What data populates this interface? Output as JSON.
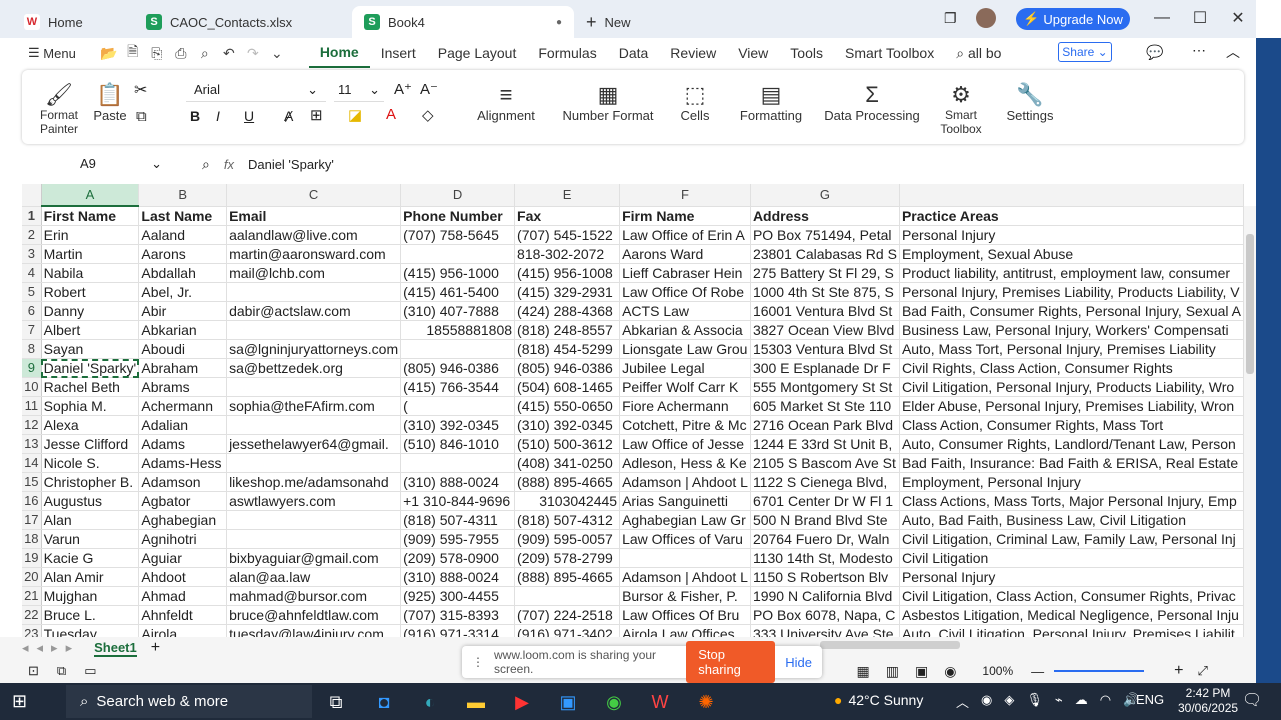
{
  "tabs": [
    {
      "label": "Home",
      "icon": "wps-logo-icon"
    },
    {
      "label": "CAOC_Contacts.xlsx",
      "icon": "spreadsheet-icon"
    },
    {
      "label": "Book4",
      "icon": "spreadsheet-icon"
    },
    {
      "label": "New"
    }
  ],
  "upgrade": "Upgrade Now",
  "menu": {
    "main": "Menu",
    "items": [
      "Home",
      "Insert",
      "Page Layout",
      "Formulas",
      "Data",
      "Review",
      "View",
      "Tools",
      "Smart Toolbox"
    ],
    "search_value": "all bo",
    "share": "Share"
  },
  "ribbon": {
    "format_painter": "Format Painter",
    "paste": "Paste",
    "font": "Arial",
    "size": "11",
    "alignment": "Alignment",
    "number_format": "Number Format",
    "cells": "Cells",
    "formatting": "Formatting",
    "data_processing": "Data Processing",
    "smart_toolbox": "Smart Toolbox",
    "settings": "Settings"
  },
  "formula": {
    "name_box": "A9",
    "fx": "fx",
    "content": "Daniel 'Sparky'"
  },
  "columns": [
    "A",
    "B",
    "C",
    "D",
    "E",
    "F",
    "G",
    ""
  ],
  "rows": [
    [
      "First Name",
      "Last Name",
      "Email",
      "Phone Number",
      "Fax",
      "Firm Name",
      "Address",
      "Practice Areas"
    ],
    [
      "Erin",
      "Aaland",
      "aalandlaw@live.com",
      "(707) 758-5645",
      "(707) 545-1522",
      "Law Office of Erin A",
      "PO Box 751494, Petal",
      "Personal Injury"
    ],
    [
      "Martin",
      "Aarons",
      "martin@aaronsward.com",
      "",
      "818-302-2072",
      "Aarons Ward",
      "23801 Calabasas Rd S",
      "Employment, Sexual Abuse"
    ],
    [
      "Nabila",
      "Abdallah",
      "mail@lchb.com",
      "(415) 956-1000",
      "(415) 956-1008",
      "Lieff Cabraser Hein",
      "275 Battery St Fl 29, S",
      "Product liability, antitrust, employment law, consumer"
    ],
    [
      "Robert",
      "Abel, Jr.",
      "",
      "(415) 461-5400",
      "(415) 329-2931",
      "Law Office Of Robe",
      "1000 4th St Ste 875, S",
      "Personal Injury, Premises Liability, Products Liability, V"
    ],
    [
      "Danny",
      "Abir",
      "dabir@actslaw.com",
      "(310) 407-7888",
      "(424) 288-4368",
      "ACTS Law",
      "16001 Ventura Blvd St",
      "Bad Faith, Consumer Rights, Personal Injury, Sexual A"
    ],
    [
      "Albert",
      "Abkarian",
      "",
      "18558881808",
      "(818) 248-8557",
      "Abkarian & Associa",
      "3827 Ocean View Blvd",
      "Business Law, Personal Injury, Workers' Compensati"
    ],
    [
      "Sayan",
      "Aboudi",
      "sa@lgninjuryattorneys.com",
      "",
      "(818) 454-5299",
      "Lionsgate Law Grou",
      "15303 Ventura Blvd St",
      "Auto, Mass Tort, Personal Injury, Premises Liability"
    ],
    [
      "Daniel 'Sparky'",
      "Abraham",
      "sa@bettzedek.org",
      "(805) 946-0386",
      "(805) 946-0386",
      "Jubilee Legal",
      "300 E Esplanade Dr F",
      "Civil Rights, Class Action, Consumer Rights"
    ],
    [
      "Rachel Beth",
      "Abrams",
      "",
      "(415) 766-3544",
      "(504) 608-1465",
      "Peiffer Wolf Carr K",
      "555 Montgomery St St",
      "Civil Litigation, Personal Injury, Products Liability, Wro"
    ],
    [
      "Sophia M.",
      "Achermann",
      "sophia@theFAfirm.com",
      "(",
      "(415) 550-0650",
      "Fiore Achermann",
      "605 Market St Ste 110",
      "Elder Abuse, Personal Injury, Premises Liability, Wron"
    ],
    [
      "Alexa",
      "Adalian",
      "",
      "(310) 392-0345",
      "(310) 392-0345",
      "Cotchett, Pitre & Mc",
      "2716 Ocean Park Blvd",
      "Class Action, Consumer Rights, Mass Tort"
    ],
    [
      "Jesse Clifford",
      "Adams",
      "jessethelawyer64@gmail.",
      "(510) 846-1010",
      "(510) 500-3612",
      "Law Office of Jesse",
      "1244 E 33rd St Unit B,",
      "Auto, Consumer Rights, Landlord/Tenant Law, Person"
    ],
    [
      "Nicole S.",
      "Adams-Hess",
      "",
      "",
      "(408) 341-0250",
      "Adleson, Hess & Ke",
      "2105 S Bascom Ave St",
      "Bad Faith, Insurance: Bad Faith & ERISA, Real Estate"
    ],
    [
      "Christopher B.",
      "Adamson",
      "likeshop.me/adamsonahd",
      "(310) 888-0024",
      "(888) 895-4665",
      "Adamson | Ahdoot L",
      "1122 S Cienega Blvd,",
      "Employment, Personal Injury"
    ],
    [
      "Augustus",
      "Agbator",
      "aswtlawyers.com",
      "+1 310-844-9696",
      "3103042445",
      "Arias Sanguinetti",
      "6701 Center Dr W Fl 1",
      "Class Actions, Mass Torts, Major Personal Injury, Emp"
    ],
    [
      "Alan",
      "Aghabegian",
      "",
      "(818) 507-4311",
      "(818) 507-4312",
      "Aghabegian Law Gr",
      "500 N Brand Blvd Ste",
      "Auto, Bad Faith, Business Law, Civil Litigation"
    ],
    [
      "Varun",
      "Agnihotri",
      "",
      "(909) 595-7955",
      "(909) 595-0057",
      "Law Offices of Varu",
      "20764 Fuero Dr, Waln",
      "Civil Litigation, Criminal Law, Family Law, Personal Inj"
    ],
    [
      "Kacie G",
      "Aguiar",
      "bixbyaguiar@gmail.com",
      "(209) 578-0900",
      "(209) 578-2799",
      "",
      "1130 14th St, Modesto",
      "Civil Litigation"
    ],
    [
      "Alan Amir",
      "Ahdoot",
      "alan@aa.law",
      "(310) 888-0024",
      "(888) 895-4665",
      "Adamson | Ahdoot L",
      "1150 S Robertson Blv",
      "Personal Injury"
    ],
    [
      "Mujghan",
      "Ahmad",
      "mahmad@bursor.com",
      "(925) 300-4455",
      "",
      "Bursor & Fisher, P.",
      "1990 N California Blvd",
      "Civil Litigation, Class Action, Consumer Rights, Privac"
    ],
    [
      "Bruce L.",
      "Ahnfeldt",
      "bruce@ahnfeldtlaw.com",
      "(707) 315-8393",
      "(707) 224-2518",
      "Law Offices Of Bru",
      "PO Box 6078, Napa, C",
      "Asbestos Litigation, Medical Negligence, Personal Inju"
    ],
    [
      "Tuesday",
      "Airola",
      "tuesday@law4injury.com",
      "(916) 971-3314",
      "(916) 971-3402",
      "Airola Law Offices",
      "333 University Ave Ste",
      "Auto, Civil Litigation, Personal Injury, Premises Liabilit"
    ]
  ],
  "sheet": "Sheet1",
  "loom": {
    "message": "www.loom.com is sharing your screen.",
    "stop": "Stop sharing",
    "hide": "Hide"
  },
  "zoom": "100%",
  "taskbar": {
    "search": "Search web & more",
    "weather": "42°C  Sunny",
    "lang": "ENG",
    "time": "2:42 PM",
    "date": "30/06/2025"
  }
}
